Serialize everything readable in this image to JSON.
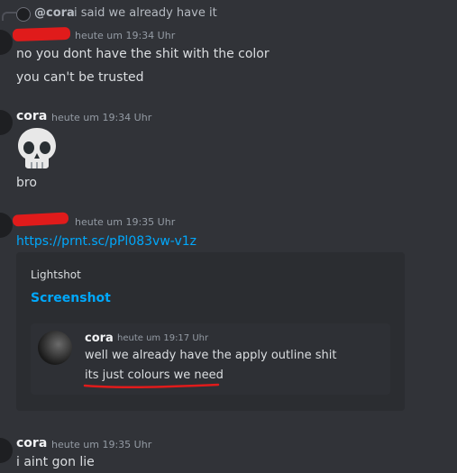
{
  "reply_preview": {
    "username": "@cora",
    "text": "i said we already have it"
  },
  "messages": [
    {
      "timestamp": "heute um 19:34 Uhr",
      "lines": [
        "no you dont have the shit with the color",
        "you can't be trusted"
      ]
    },
    {
      "username": "cora",
      "timestamp": "heute um 19:34 Uhr",
      "emoji": "skull",
      "lines": [
        "bro"
      ]
    },
    {
      "timestamp": "heute um 19:35 Uhr",
      "link": "https://prnt.sc/pPl083vw-v1z",
      "embed": {
        "provider": "Lightshot",
        "title": "Screenshot",
        "quoted": {
          "username": "cora",
          "timestamp": "heute um 19:17 Uhr",
          "lines": [
            "well we already have the apply outline shit",
            "its just colours we need"
          ]
        }
      }
    },
    {
      "username": "cora",
      "timestamp": "heute um 19:35 Uhr",
      "lines": [
        "i aint gon lie"
      ]
    }
  ],
  "colors": {
    "background": "#313338",
    "embed_background": "#2b2d31",
    "link": "#00a8fc",
    "redaction": "#e01b1b"
  }
}
